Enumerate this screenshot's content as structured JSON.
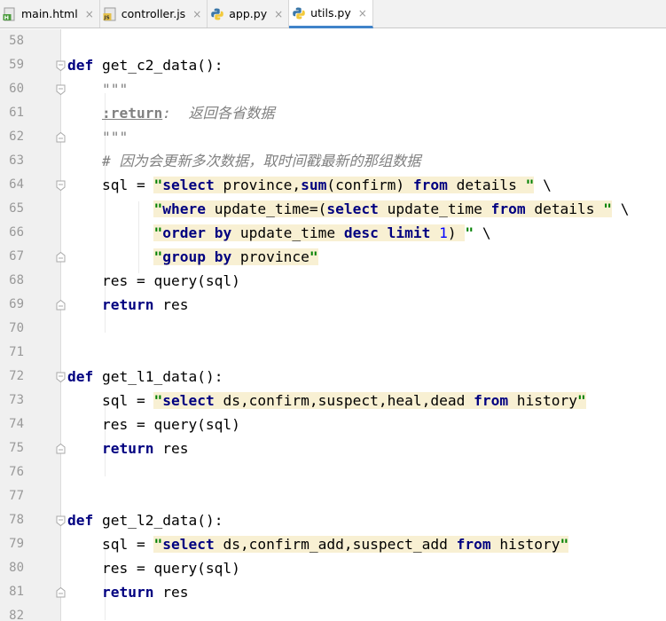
{
  "tabs": [
    {
      "label": "main.html",
      "icon": "html-file-icon",
      "active": false
    },
    {
      "label": "controller.js",
      "icon": "js-file-icon",
      "active": false
    },
    {
      "label": "app.py",
      "icon": "python-file-icon",
      "active": false
    },
    {
      "label": "utils.py",
      "icon": "python-file-icon",
      "active": true
    }
  ],
  "tab_close_glyph": "×",
  "colors": {
    "keyword": "#000080",
    "string": "#008000",
    "comment": "#808080",
    "number": "#0000ff",
    "injected_sql_bg": "#f8f0d3",
    "active_tab_underline": "#4083c9"
  },
  "editor": {
    "lines": [
      {
        "num": "58",
        "code": []
      },
      {
        "num": "59",
        "fold": "open",
        "code": [
          {
            "t": "def",
            "c": "kw"
          },
          {
            "t": " get_c2_data():",
            "c": ""
          }
        ]
      },
      {
        "num": "60",
        "fold": "open",
        "code": [
          {
            "t": "    ",
            "c": ""
          },
          {
            "t": "\"\"\"",
            "c": "doc"
          }
        ]
      },
      {
        "num": "61",
        "code": [
          {
            "t": "    ",
            "c": ""
          },
          {
            "t": ":return",
            "c": "doctag"
          },
          {
            "t": ":  返回各省数据",
            "c": "doc"
          }
        ]
      },
      {
        "num": "62",
        "fold": "close",
        "code": [
          {
            "t": "    ",
            "c": ""
          },
          {
            "t": "\"\"\"",
            "c": "doc"
          }
        ]
      },
      {
        "num": "63",
        "code": [
          {
            "t": "    ",
            "c": ""
          },
          {
            "t": "# 因为会更新多次数据，取时间戳最新的那组数据",
            "c": "cmt"
          }
        ]
      },
      {
        "num": "64",
        "fold": "open",
        "code": [
          {
            "t": "    sql = ",
            "c": ""
          },
          {
            "t": "\"",
            "c": "str inj"
          },
          {
            "t": "select",
            "c": "sqlkw inj"
          },
          {
            "t": " province,",
            "c": "sqltxt inj"
          },
          {
            "t": "sum",
            "c": "sqlkw inj"
          },
          {
            "t": "(confirm) ",
            "c": "sqltxt inj"
          },
          {
            "t": "from",
            "c": "sqlkw inj"
          },
          {
            "t": " details ",
            "c": "sqltxt inj"
          },
          {
            "t": "\"",
            "c": "str inj"
          },
          {
            "t": " \\",
            "c": ""
          }
        ]
      },
      {
        "num": "65",
        "code": [
          {
            "t": "          ",
            "c": ""
          },
          {
            "t": "\"",
            "c": "str inj"
          },
          {
            "t": "where",
            "c": "sqlkw inj"
          },
          {
            "t": " update_time=(",
            "c": "sqltxt inj"
          },
          {
            "t": "select",
            "c": "sqlkw inj"
          },
          {
            "t": " update_time ",
            "c": "sqltxt inj"
          },
          {
            "t": "from",
            "c": "sqlkw inj"
          },
          {
            "t": " details ",
            "c": "sqltxt inj"
          },
          {
            "t": "\"",
            "c": "str inj"
          },
          {
            "t": " \\",
            "c": ""
          }
        ]
      },
      {
        "num": "66",
        "code": [
          {
            "t": "          ",
            "c": ""
          },
          {
            "t": "\"",
            "c": "str inj"
          },
          {
            "t": "order by",
            "c": "sqlkw inj"
          },
          {
            "t": " update_time ",
            "c": "sqltxt inj"
          },
          {
            "t": "desc limit",
            "c": "sqlkw inj"
          },
          {
            "t": " ",
            "c": "sqltxt inj"
          },
          {
            "t": "1",
            "c": "num inj"
          },
          {
            "t": ") ",
            "c": "sqltxt inj"
          },
          {
            "t": "\"",
            "c": "str"
          },
          {
            "t": " \\",
            "c": ""
          }
        ]
      },
      {
        "num": "67",
        "fold": "close",
        "code": [
          {
            "t": "          ",
            "c": ""
          },
          {
            "t": "\"",
            "c": "str inj"
          },
          {
            "t": "group by",
            "c": "sqlkw inj"
          },
          {
            "t": " province",
            "c": "sqltxt inj"
          },
          {
            "t": "\"",
            "c": "str inj"
          }
        ]
      },
      {
        "num": "68",
        "code": [
          {
            "t": "    res = query(sql)",
            "c": ""
          }
        ]
      },
      {
        "num": "69",
        "fold": "close",
        "code": [
          {
            "t": "    ",
            "c": ""
          },
          {
            "t": "return",
            "c": "kw"
          },
          {
            "t": " res",
            "c": ""
          }
        ]
      },
      {
        "num": "70",
        "code": []
      },
      {
        "num": "71",
        "code": []
      },
      {
        "num": "72",
        "fold": "open",
        "code": [
          {
            "t": "def",
            "c": "kw"
          },
          {
            "t": " get_l1_data():",
            "c": ""
          }
        ]
      },
      {
        "num": "73",
        "code": [
          {
            "t": "    sql = ",
            "c": ""
          },
          {
            "t": "\"",
            "c": "str inj"
          },
          {
            "t": "select",
            "c": "sqlkw inj"
          },
          {
            "t": " ds,confirm,suspect,heal,dead ",
            "c": "sqltxt inj"
          },
          {
            "t": "from",
            "c": "sqlkw inj"
          },
          {
            "t": " history",
            "c": "sqltxt inj"
          },
          {
            "t": "\"",
            "c": "str inj"
          }
        ]
      },
      {
        "num": "74",
        "code": [
          {
            "t": "    res = query(sql)",
            "c": ""
          }
        ]
      },
      {
        "num": "75",
        "fold": "close",
        "code": [
          {
            "t": "    ",
            "c": ""
          },
          {
            "t": "return",
            "c": "kw"
          },
          {
            "t": " res",
            "c": ""
          }
        ]
      },
      {
        "num": "76",
        "code": []
      },
      {
        "num": "77",
        "code": []
      },
      {
        "num": "78",
        "fold": "open",
        "code": [
          {
            "t": "def",
            "c": "kw"
          },
          {
            "t": " get_l2_data():",
            "c": ""
          }
        ]
      },
      {
        "num": "79",
        "code": [
          {
            "t": "    sql = ",
            "c": ""
          },
          {
            "t": "\"",
            "c": "str inj"
          },
          {
            "t": "select",
            "c": "sqlkw inj"
          },
          {
            "t": " ds,confirm_add,suspect_add ",
            "c": "sqltxt inj"
          },
          {
            "t": "from",
            "c": "sqlkw inj"
          },
          {
            "t": " history",
            "c": "sqltxt inj"
          },
          {
            "t": "\"",
            "c": "str inj"
          }
        ]
      },
      {
        "num": "80",
        "code": [
          {
            "t": "    res = query(sql)",
            "c": ""
          }
        ]
      },
      {
        "num": "81",
        "fold": "close",
        "code": [
          {
            "t": "    ",
            "c": ""
          },
          {
            "t": "return",
            "c": "kw"
          },
          {
            "t": " res",
            "c": ""
          }
        ]
      },
      {
        "num": "82",
        "code": []
      }
    ]
  }
}
